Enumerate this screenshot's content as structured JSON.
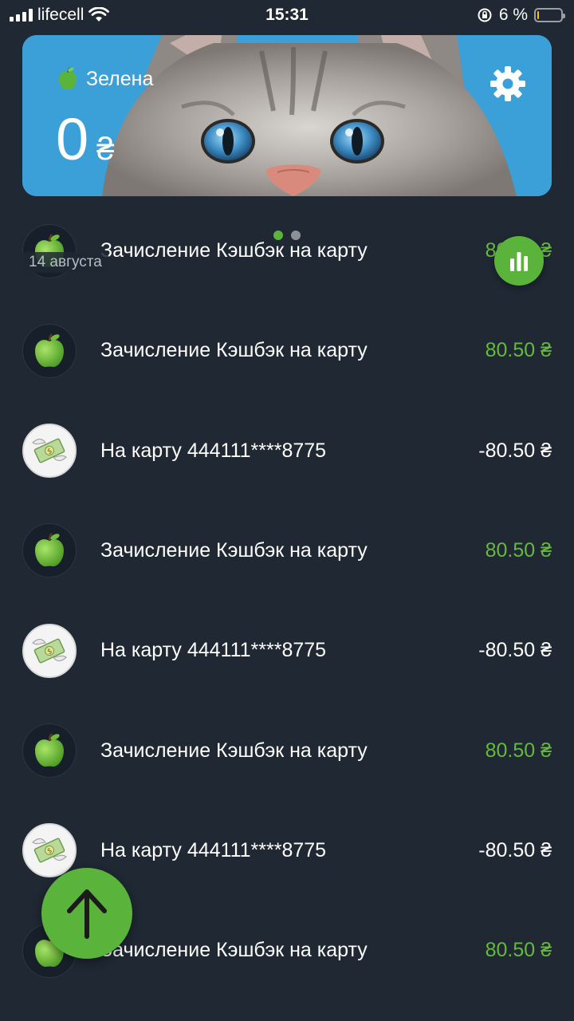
{
  "status_bar": {
    "carrier": "lifecell",
    "time": "15:31",
    "battery_percent": "6 %",
    "battery_level": 0.06,
    "icons": [
      "signal-icon",
      "wifi-icon",
      "orientation-lock-icon",
      "battery-icon"
    ]
  },
  "card": {
    "name": "Зелена",
    "balance": "0",
    "currency": "₴",
    "icons": [
      "apple-icon",
      "gear-icon"
    ],
    "page_count": 2,
    "active_page": 0
  },
  "date_header": "14 августа",
  "transactions": [
    {
      "icon": "apple-icon",
      "title": "Зачисление Кэшбэк на карту",
      "amount": "80.50 ₴",
      "type": "credit"
    },
    {
      "icon": "apple-icon",
      "title": "Зачисление Кэшбэк на карту",
      "amount": "80.50 ₴",
      "type": "credit"
    },
    {
      "icon": "money-with-wings-icon",
      "title": "На карту 444111****8775",
      "amount": "-80.50 ₴",
      "type": "debit"
    },
    {
      "icon": "apple-icon",
      "title": "Зачисление Кэшбэк на карту",
      "amount": "80.50 ₴",
      "type": "credit"
    },
    {
      "icon": "money-with-wings-icon",
      "title": "На карту 444111****8775",
      "amount": "-80.50 ₴",
      "type": "debit"
    },
    {
      "icon": "apple-icon",
      "title": "Зачисление Кэшбэк на карту",
      "amount": "80.50 ₴",
      "type": "credit"
    },
    {
      "icon": "money-with-wings-icon",
      "title": "На карту 444111****8775",
      "amount": "-80.50 ₴",
      "type": "debit"
    },
    {
      "icon": "apple-icon",
      "title": "Зачисление Кэшбэк на карту",
      "amount": "80.50 ₴",
      "type": "credit"
    }
  ],
  "colors": {
    "background": "#1f2833",
    "accent_green": "#5ab43b",
    "credit_green": "#67b83f",
    "card_blue": "#3b9fd8"
  },
  "fabs": {
    "stats": "bar-chart-icon",
    "send": "arrow-up-icon"
  }
}
